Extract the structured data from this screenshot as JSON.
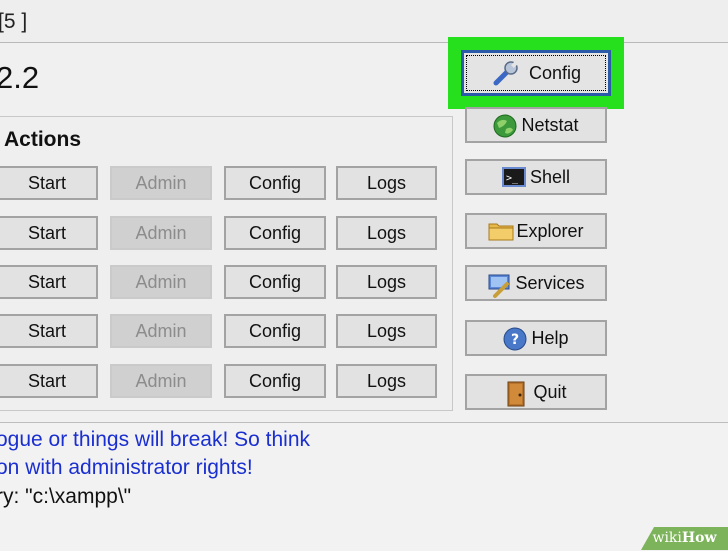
{
  "window": {
    "title_fragment": "[5 ]",
    "version_fragment": "2.2"
  },
  "modules": {
    "group_label": "Actions",
    "rows": [
      {
        "start": "Start",
        "admin": "Admin",
        "config": "Config",
        "logs": "Logs"
      },
      {
        "start": "Start",
        "admin": "Admin",
        "config": "Config",
        "logs": "Logs"
      },
      {
        "start": "Start",
        "admin": "Admin",
        "config": "Config",
        "logs": "Logs"
      },
      {
        "start": "Start",
        "admin": "Admin",
        "config": "Config",
        "logs": "Logs"
      },
      {
        "start": "Start",
        "admin": "Admin",
        "config": "Config",
        "logs": "Logs"
      }
    ]
  },
  "sidebar": {
    "config": "Config",
    "netstat": "Netstat",
    "shell": "Shell",
    "explorer": "Explorer",
    "services": "Services",
    "help": "Help",
    "quit": "Quit"
  },
  "log": {
    "lines": [
      "ogue or things will break! So think",
      "on with administrator rights!",
      "ry: \"c:\\xampp\\\""
    ]
  },
  "watermark": {
    "wiki": "wiki",
    "how": "How"
  },
  "colors": {
    "highlight": "#27e01d",
    "log_blue": "#1a2fd0",
    "watermark_bg": "#7db35a"
  },
  "icons": {
    "config": "wrench-icon",
    "netstat": "globe-icon",
    "shell": "terminal-icon",
    "explorer": "folder-icon",
    "services": "services-icon",
    "help": "help-icon",
    "quit": "door-icon"
  }
}
